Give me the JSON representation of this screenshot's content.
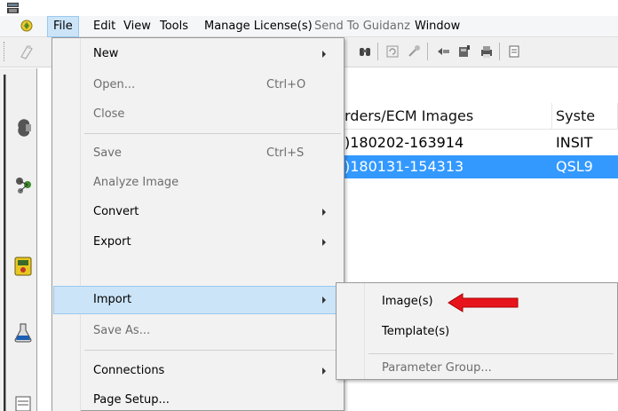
{
  "menubar": {
    "items": [
      {
        "label": "File",
        "active": true
      },
      {
        "label": "Edit"
      },
      {
        "label": "View"
      },
      {
        "label": "Tools"
      },
      {
        "label": "Manage License(s)"
      },
      {
        "label": "Send To Guidanz",
        "disabled": true
      },
      {
        "label": "Window"
      }
    ]
  },
  "table": {
    "columns": [
      "rders/ECM Images",
      "Syste"
    ],
    "rows": [
      {
        "col1": ")180202-163914",
        "col2": "INSIT",
        "selected": false
      },
      {
        "col1": ")180131-154313",
        "col2": "QSL9",
        "selected": true
      }
    ]
  },
  "file_menu": {
    "items": [
      {
        "label": "New",
        "shortcut": "",
        "submenu": true,
        "disabled": false
      },
      {
        "label": "Open...",
        "shortcut": "Ctrl+O",
        "submenu": false,
        "disabled": true
      },
      {
        "label": "Close",
        "shortcut": "",
        "submenu": false,
        "disabled": true
      },
      {
        "label": "Save",
        "shortcut": "Ctrl+S",
        "submenu": false,
        "disabled": true
      },
      {
        "label": "Analyze Image",
        "shortcut": "",
        "submenu": false,
        "disabled": true
      },
      {
        "label": "Convert",
        "shortcut": "",
        "submenu": true,
        "disabled": false
      },
      {
        "label": "Export",
        "shortcut": "",
        "submenu": true,
        "disabled": false
      },
      {
        "label": "Import",
        "shortcut": "",
        "submenu": true,
        "disabled": false,
        "highlighted": true
      },
      {
        "label": "Save As...",
        "shortcut": "",
        "submenu": false,
        "disabled": true
      },
      {
        "label": "Connections",
        "shortcut": "",
        "submenu": true,
        "disabled": false
      },
      {
        "label": "Page Setup...",
        "shortcut": "",
        "submenu": false,
        "disabled": false
      }
    ]
  },
  "import_submenu": {
    "items": [
      {
        "label": "Image(s)",
        "disabled": false,
        "annotated": true
      },
      {
        "label": "Template(s)",
        "disabled": false
      },
      {
        "label": "Parameter Group...",
        "disabled": true
      }
    ]
  },
  "colors": {
    "selection": "#3399ff",
    "menu_hover": "#cce4f7",
    "annotation_arrow": "#e8141c"
  },
  "icons": {
    "app": "app-window-icon",
    "logo": "app-logo-icon",
    "annotation": "red-arrow-icon"
  }
}
